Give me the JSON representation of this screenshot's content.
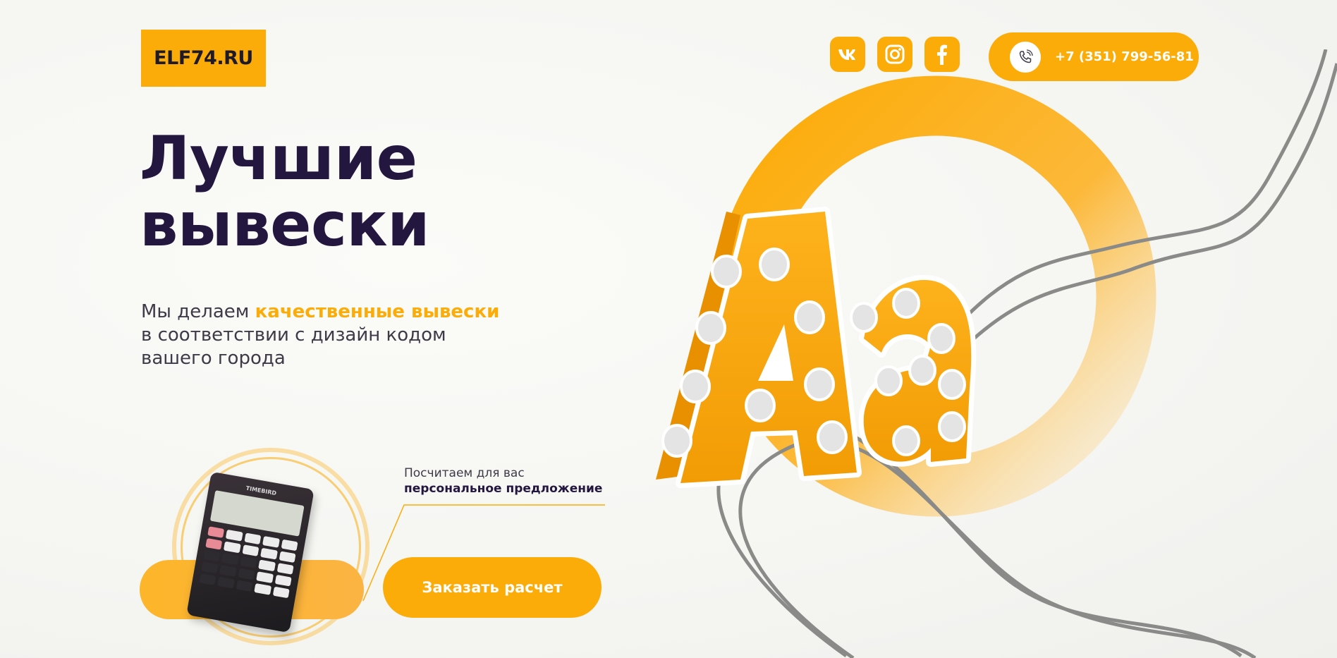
{
  "header": {
    "logo_text": "ELF74.RU",
    "socials": [
      {
        "name": "vk-icon",
        "glyph": "VK"
      },
      {
        "name": "instagram-icon",
        "glyph": "ig"
      },
      {
        "name": "facebook-icon",
        "glyph": "f"
      }
    ],
    "phone": "+7 (351) 799-56-81"
  },
  "hero": {
    "headline_line1": "Лучшие",
    "headline_line2": "вывески",
    "subtitle_prefix": "Мы делаем ",
    "subtitle_accent": "качественные вывески",
    "subtitle_line2": "в соответствии с дизайн кодом",
    "subtitle_line3": "вашего города",
    "art_letters": "Aa"
  },
  "offer": {
    "calc_brand": "TIMEBIRD",
    "line1": "Посчитаем для вас",
    "line2": "персональное предложение",
    "cta_label": "Заказать расчет"
  },
  "colors": {
    "accent": "#fcac08",
    "headline": "#24173f",
    "text": "#3f3a48"
  }
}
